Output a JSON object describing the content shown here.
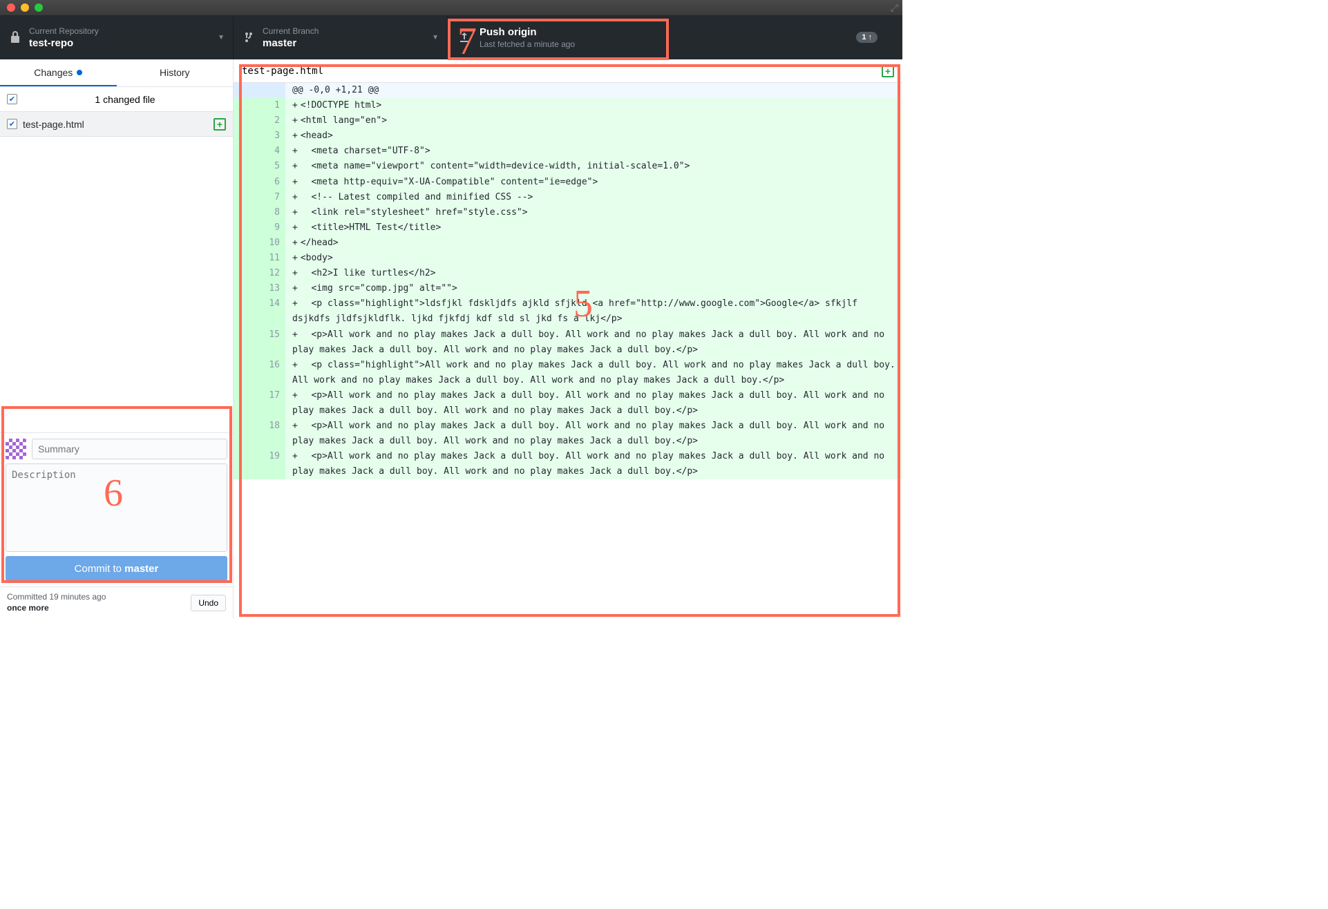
{
  "toolbar": {
    "repo_label": "Current Repository",
    "repo_value": "test-repo",
    "branch_label": "Current Branch",
    "branch_value": "master",
    "push_label": "Push origin",
    "push_sub": "Last fetched a minute ago",
    "push_badge": "1 ↑"
  },
  "tabs": {
    "changes": "Changes",
    "history": "History"
  },
  "changes_header": "1 changed file",
  "file_item": "test-page.html",
  "commit": {
    "summary_placeholder": "Summary",
    "desc_placeholder": "Description",
    "button_prefix": "Commit to ",
    "button_branch": "master"
  },
  "footer": {
    "line1": "Committed 19 minutes ago",
    "line2": "once more",
    "undo": "Undo"
  },
  "file_header": "test-page.html",
  "hunk_header": "@@ -0,0 +1,21 @@",
  "diff_lines": [
    {
      "n": 1,
      "t": "<!DOCTYPE html>"
    },
    {
      "n": 2,
      "t": "<html lang=\"en\">"
    },
    {
      "n": 3,
      "t": "<head>"
    },
    {
      "n": 4,
      "t": "  <meta charset=\"UTF-8\">"
    },
    {
      "n": 5,
      "t": "  <meta name=\"viewport\" content=\"width=device-width, initial-scale=1.0\">"
    },
    {
      "n": 6,
      "t": "  <meta http-equiv=\"X-UA-Compatible\" content=\"ie=edge\">"
    },
    {
      "n": 7,
      "t": "  <!-- Latest compiled and minified CSS -->"
    },
    {
      "n": 8,
      "t": "  <link rel=\"stylesheet\" href=\"style.css\">"
    },
    {
      "n": 9,
      "t": "  <title>HTML Test</title>"
    },
    {
      "n": 10,
      "t": "</head>"
    },
    {
      "n": 11,
      "t": "<body>"
    },
    {
      "n": 12,
      "t": "  <h2>I like turtles</h2>"
    },
    {
      "n": 13,
      "t": "  <img src=\"comp.jpg\" alt=\"\">"
    },
    {
      "n": 14,
      "t": "  <p class=\"highlight\">ldsfjkl fdskljdfs ajkld sfjkld <a href=\"http://www.google.com\">Google</a> sfkjlf dsjkdfs jldfsjkldflk. ljkd fjkfdj kdf sld sl jkd fs a lkj</p>"
    },
    {
      "n": 15,
      "t": "  <p>All work and no play makes Jack a dull boy. All work and no play makes Jack a dull boy. All work and no play makes Jack a dull boy. All work and no play makes Jack a dull boy.</p>"
    },
    {
      "n": 16,
      "t": "  <p class=\"highlight\">All work and no play makes Jack a dull boy. All work and no play makes Jack a dull boy. All work and no play makes Jack a dull boy. All work and no play makes Jack a dull boy.</p>"
    },
    {
      "n": 17,
      "t": "  <p>All work and no play makes Jack a dull boy. All work and no play makes Jack a dull boy. All work and no play makes Jack a dull boy. All work and no play makes Jack a dull boy.</p>"
    },
    {
      "n": 18,
      "t": "  <p>All work and no play makes Jack a dull boy. All work and no play makes Jack a dull boy. All work and no play makes Jack a dull boy. All work and no play makes Jack a dull boy.</p>"
    },
    {
      "n": 19,
      "t": "  <p>All work and no play makes Jack a dull boy. All work and no play makes Jack a dull boy. All work and no play makes Jack a dull boy. All work and no play makes Jack a dull boy.</p>"
    }
  ],
  "annotations": {
    "five": "5",
    "six": "6",
    "seven": "7"
  }
}
